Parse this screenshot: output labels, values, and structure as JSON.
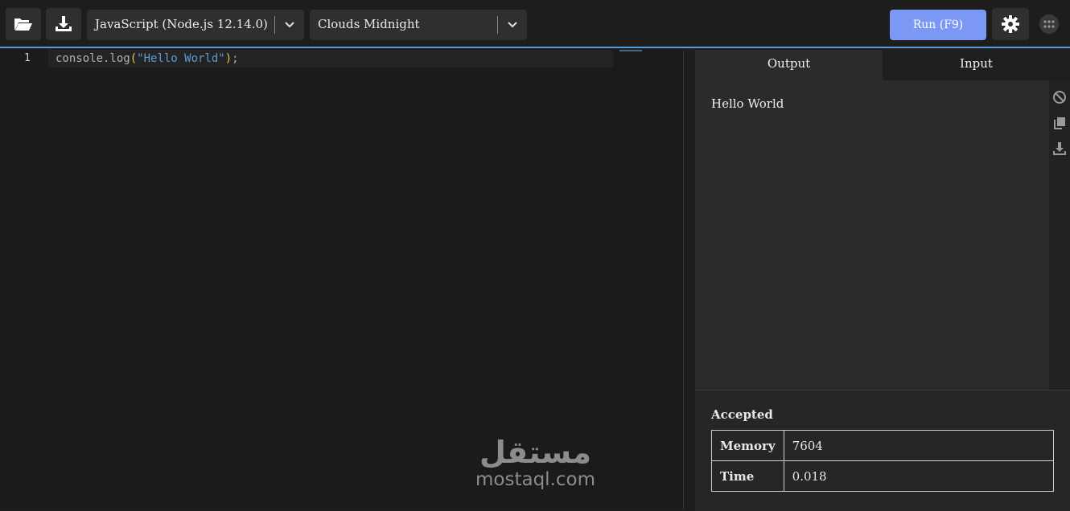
{
  "toolbar": {
    "open_icon": "folder-open-icon",
    "download_icon": "download-icon",
    "language": "JavaScript (Node.js 12.14.0)",
    "theme": "Clouds Midnight",
    "run_label": "Run (F9)",
    "settings_icon": "gear-icon",
    "apps_icon": "grid-icon",
    "accent": "#7b98f5"
  },
  "editor": {
    "line_number": "1",
    "code_prefix": "console.log",
    "code_open": "(",
    "code_string": "\"Hello World\"",
    "code_close": ")",
    "code_semi": ";"
  },
  "watermark": {
    "arabic": "مستقل",
    "latin": "mostaql.com"
  },
  "panel": {
    "tabs": [
      "Output",
      "Input"
    ],
    "output_text": "Hello World",
    "status": "Accepted",
    "stats": [
      {
        "label": "Memory",
        "value": "7604"
      },
      {
        "label": "Time",
        "value": "0.018"
      }
    ]
  }
}
